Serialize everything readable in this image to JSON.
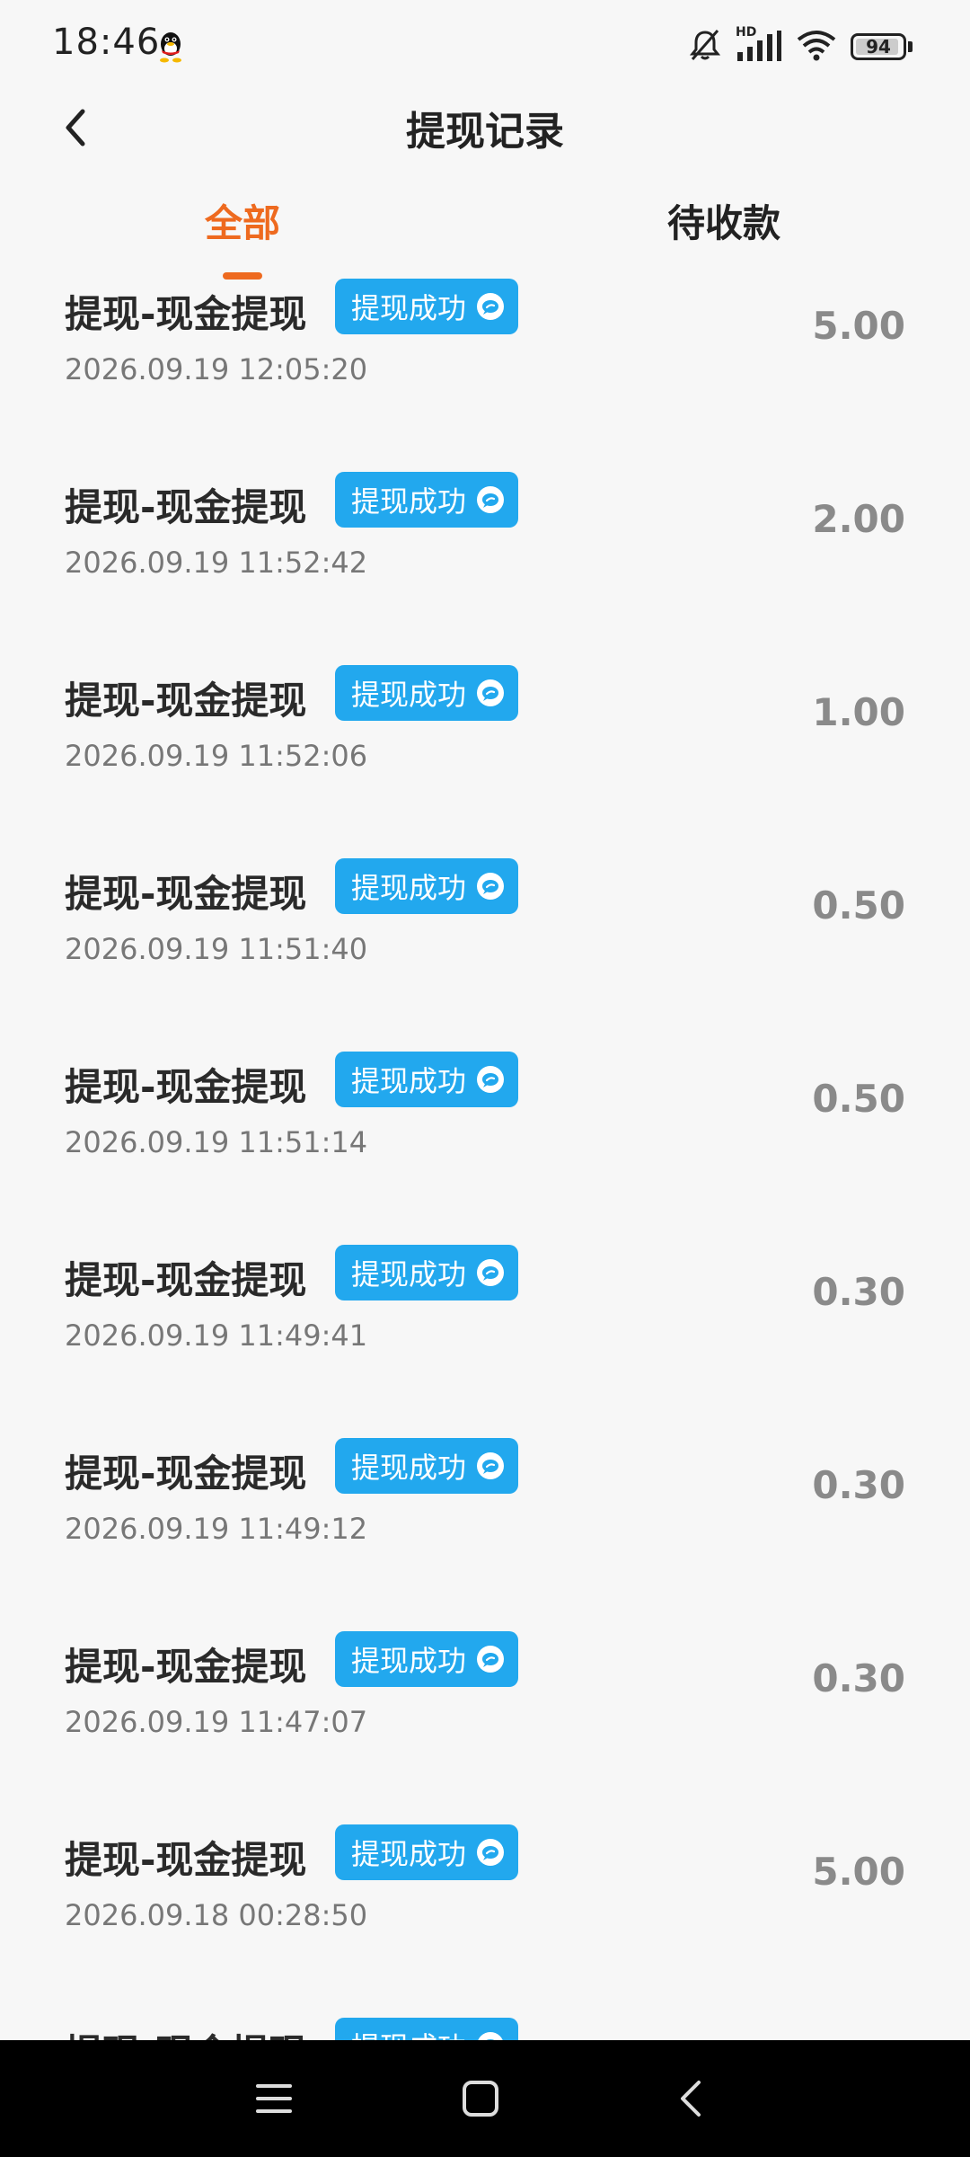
{
  "status_bar": {
    "time": "18:46",
    "icons": [
      "qq-icon",
      "bell-muted-icon",
      "hd-signal-icon",
      "wifi-icon",
      "battery-icon"
    ],
    "hd_label": "HD",
    "battery": 94
  },
  "header": {
    "title": "提现记录",
    "back_icon": "chevron-left-icon"
  },
  "tabs": [
    {
      "label": "全部",
      "active": true
    },
    {
      "label": "待收款",
      "active": false
    }
  ],
  "colors": {
    "accent": "#ee6a1f",
    "badge": "#22a8ee",
    "amount": "#8a8a8a"
  },
  "records": [
    {
      "title": "提现-现金提现",
      "status": "提现成功",
      "status_icon": "wechat-icon",
      "time": "2026.09.19 12:05:20",
      "amount": "5.00"
    },
    {
      "title": "提现-现金提现",
      "status": "提现成功",
      "status_icon": "wechat-icon",
      "time": "2026.09.19 11:52:42",
      "amount": "2.00"
    },
    {
      "title": "提现-现金提现",
      "status": "提现成功",
      "status_icon": "wechat-icon",
      "time": "2026.09.19 11:52:06",
      "amount": "1.00"
    },
    {
      "title": "提现-现金提现",
      "status": "提现成功",
      "status_icon": "wechat-icon",
      "time": "2026.09.19 11:51:40",
      "amount": "0.50"
    },
    {
      "title": "提现-现金提现",
      "status": "提现成功",
      "status_icon": "wechat-icon",
      "time": "2026.09.19 11:51:14",
      "amount": "0.50"
    },
    {
      "title": "提现-现金提现",
      "status": "提现成功",
      "status_icon": "wechat-icon",
      "time": "2026.09.19 11:49:41",
      "amount": "0.30"
    },
    {
      "title": "提现-现金提现",
      "status": "提现成功",
      "status_icon": "wechat-icon",
      "time": "2026.09.19 11:49:12",
      "amount": "0.30"
    },
    {
      "title": "提现-现金提现",
      "status": "提现成功",
      "status_icon": "wechat-icon",
      "time": "2026.09.19 11:47:07",
      "amount": "0.30"
    },
    {
      "title": "提现-现金提现",
      "status": "提现成功",
      "status_icon": "wechat-icon",
      "time": "2026.09.18 00:28:50",
      "amount": "5.00"
    },
    {
      "title": "提现-现金提现",
      "status": "提现成功",
      "status_icon": "wechat-icon",
      "time": "",
      "amount": ""
    }
  ],
  "nav_bar": {
    "buttons": [
      "menu-icon",
      "home-square-icon",
      "back-chevron-icon"
    ]
  }
}
